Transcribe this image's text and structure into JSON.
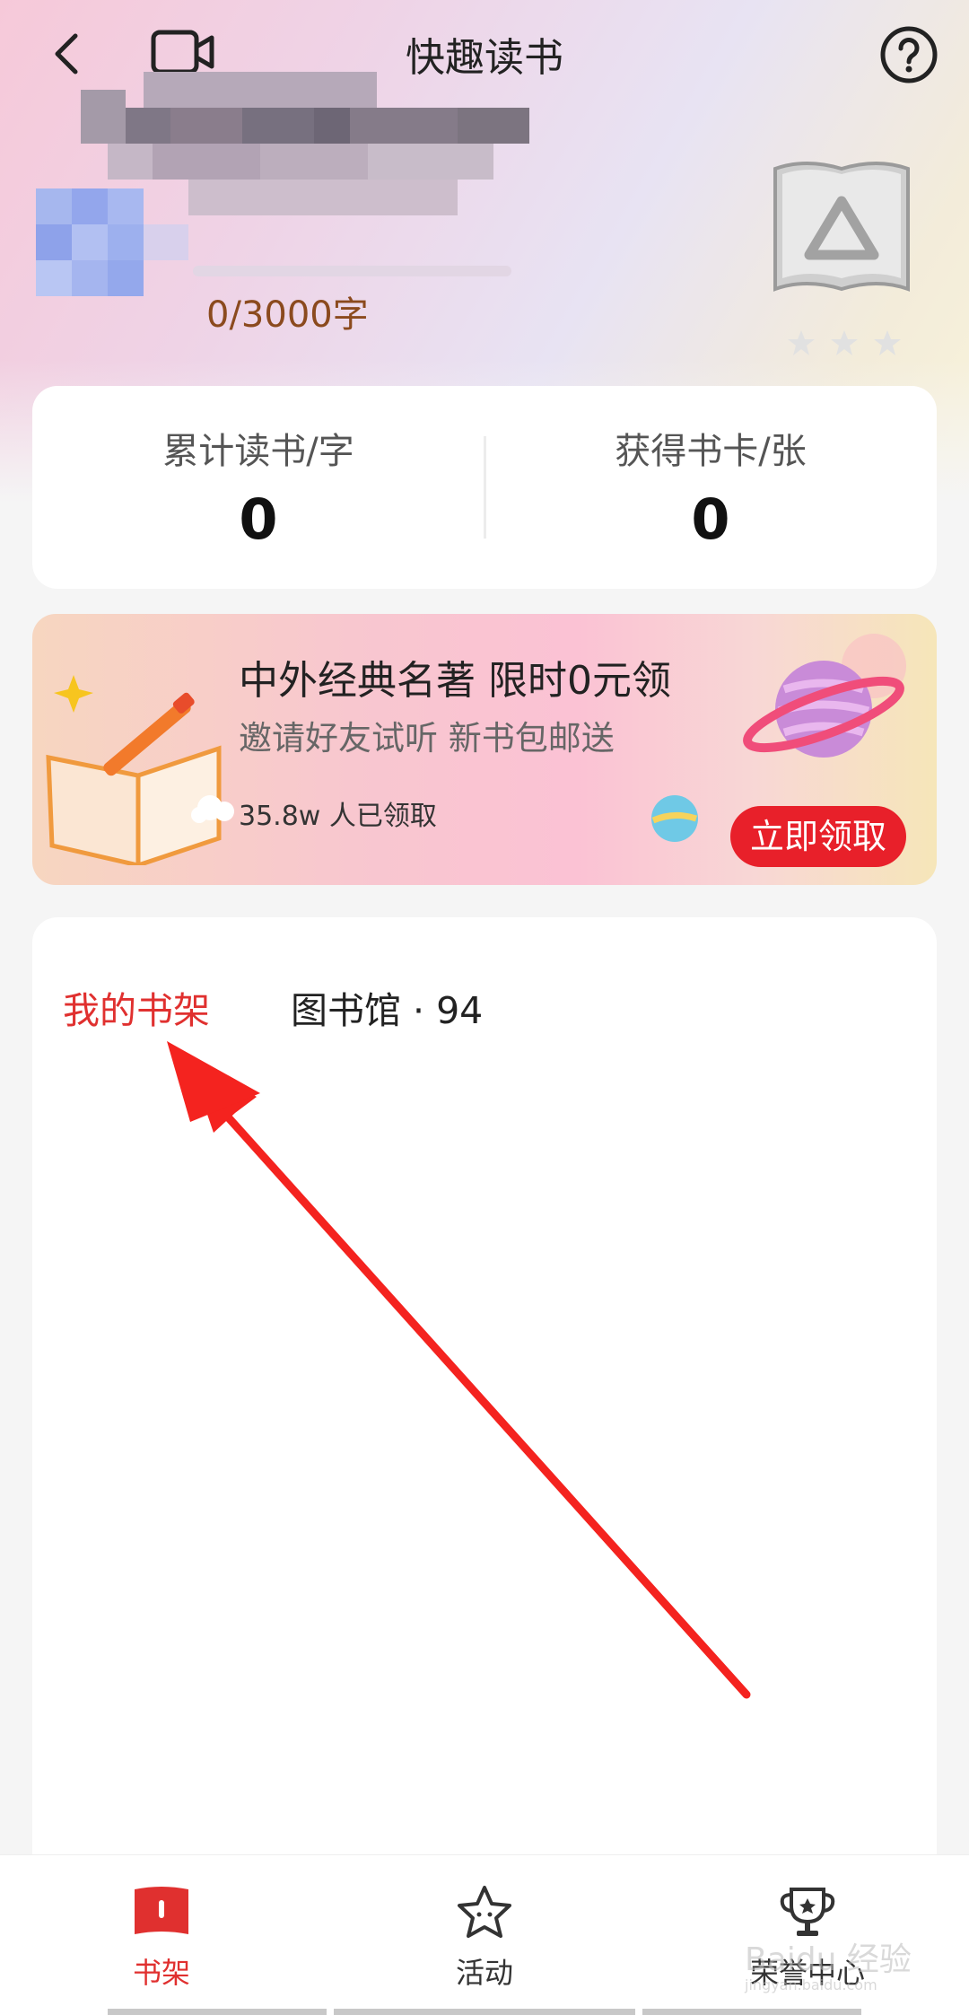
{
  "header": {
    "title": "快趣读书",
    "back_icon": "chevron-left-icon",
    "video_icon": "video-camera-icon",
    "help_icon": "question-circle-icon"
  },
  "profile": {
    "progress_text": "0/3000字",
    "badge_icon": "book-level-badge-icon",
    "stars_total": 3,
    "stars_filled": 0
  },
  "stats": {
    "items": [
      {
        "label": "累计读书/字",
        "value": "0"
      },
      {
        "label": "获得书卡/张",
        "value": "0"
      }
    ]
  },
  "promo": {
    "title": "中外经典名著 限时0元领",
    "subtitle": "邀请好友试听 新书包邮送",
    "count_text": "35.8w 人已领取",
    "button_label": "立即领取",
    "accent_color": "#e8202a"
  },
  "shelf": {
    "tabs": [
      {
        "label": "我的书架",
        "active": true
      },
      {
        "label": "图书馆 · 94",
        "active": false
      }
    ],
    "active_color": "#e0302f"
  },
  "bottom_nav": {
    "items": [
      {
        "label": "书架",
        "icon": "bookshelf-icon",
        "active": true
      },
      {
        "label": "活动",
        "icon": "star-activity-icon",
        "active": false
      },
      {
        "label": "荣誉中心",
        "icon": "trophy-icon",
        "active": false
      }
    ]
  },
  "watermark": {
    "text": "Baidu 经验",
    "sub": "jingyan.baidu.com"
  }
}
